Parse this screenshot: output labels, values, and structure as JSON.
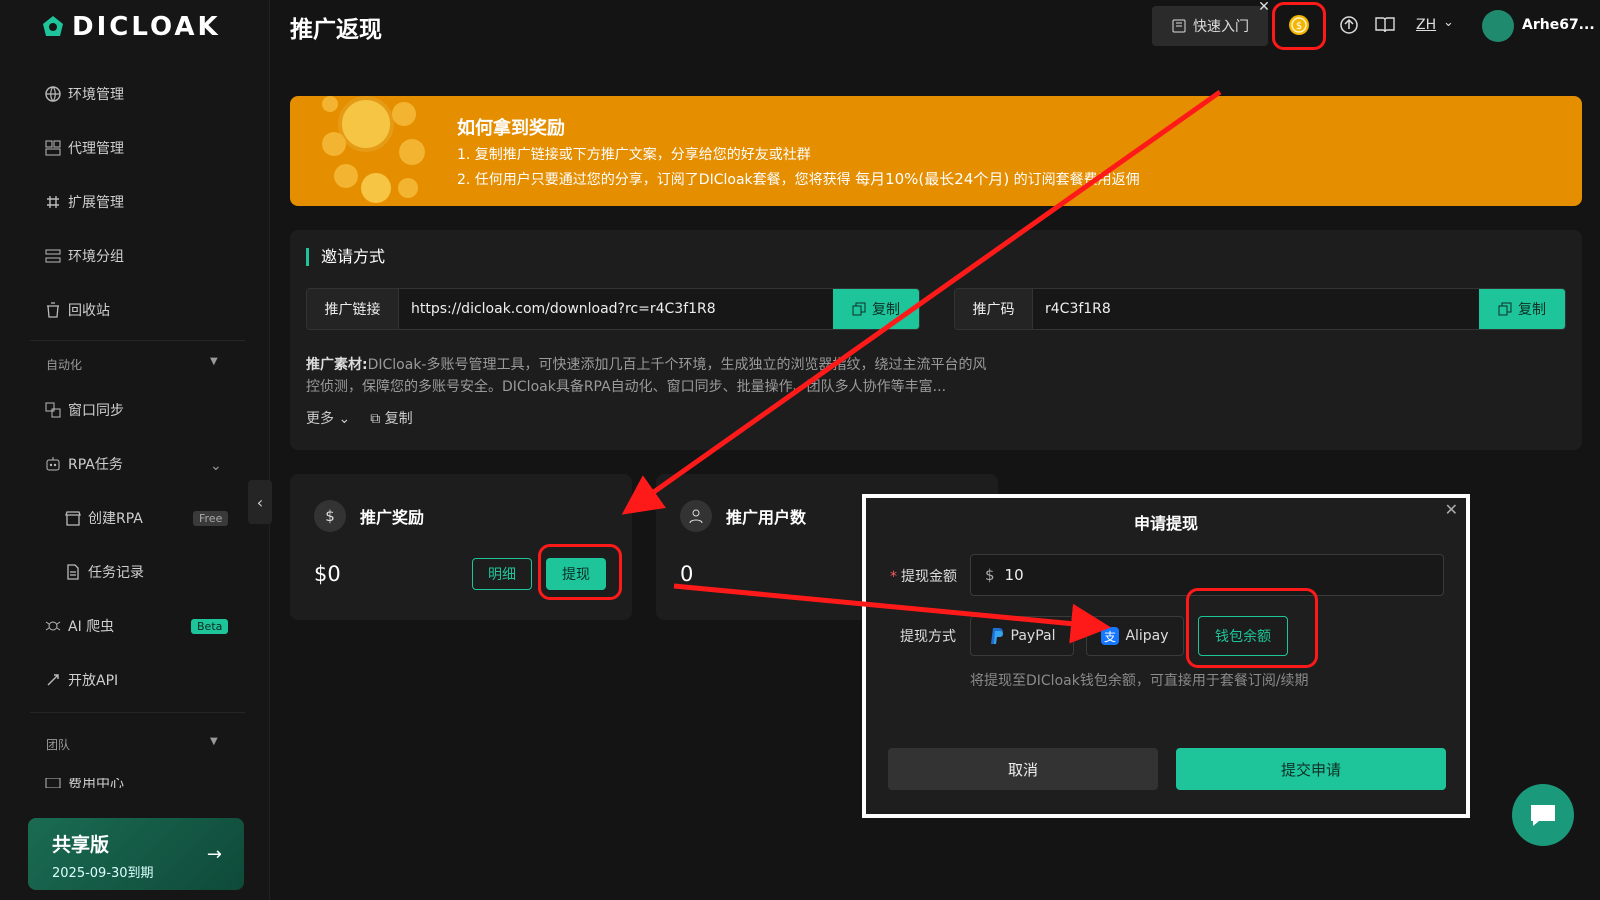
{
  "sidebar": {
    "logo": "DICLOAK",
    "items": [
      {
        "label": "环境管理",
        "icon": "globe-icon"
      },
      {
        "label": "代理管理",
        "icon": "proxy-icon"
      },
      {
        "label": "扩展管理",
        "icon": "extension-icon"
      },
      {
        "label": "环境分组",
        "icon": "group-icon"
      },
      {
        "label": "回收站",
        "icon": "trash-icon"
      }
    ],
    "automation_title": "自动化",
    "automation_items": [
      {
        "label": "窗口同步",
        "icon": "sync-icon"
      },
      {
        "label": "RPA任务",
        "icon": "robot-icon"
      },
      {
        "label": "创建RPA",
        "icon": "store-icon",
        "badge": "Free"
      },
      {
        "label": "任务记录",
        "icon": "doc-icon"
      },
      {
        "label": "AI 爬虫",
        "icon": "spider-icon",
        "badge": "Beta"
      },
      {
        "label": "开放API",
        "icon": "api-icon"
      }
    ],
    "team_title": "团队",
    "team_partial": "费用中心",
    "plan": {
      "name": "共享版",
      "expiry": "2025-09-30到期"
    }
  },
  "header": {
    "title": "推广返现",
    "quick_start": "快速入门",
    "lang": "ZH",
    "username": "Arhe67..."
  },
  "banner": {
    "title": "如何拿到奖励",
    "line1": "1. 复制推广链接或下方推广文案，分享给您的好友或社群",
    "line2_prefix": "2. 任何用户只要通过您的分享，订阅了DICloak套餐，您将获得 ",
    "line2_highlight": "每月10%(最长24个月)",
    "line2_suffix": " 的订阅套餐费用返佣"
  },
  "invite": {
    "title": "邀请方式",
    "link_label": "推广链接",
    "link_value": "https://dicloak.com/download?rc=r4C3f1R8",
    "code_label": "推广码",
    "code_value": "r4C3f1R8",
    "copy_label": "复制",
    "material_label": "推广素材:",
    "material_text": "DICloak-多账号管理工具，可快速添加几百上千个环境，生成独立的浏览器指纹，绕过主流平台的风控侦测，保障您的多账号安全。DICloak具备RPA自动化、窗口同步、批量操作、团队多人协作等丰富...",
    "more": "更多",
    "copy_text": "复制"
  },
  "stats": {
    "reward_title": "推广奖励",
    "reward_value": "$0",
    "detail_btn": "明细",
    "withdraw_btn": "提现",
    "users_title": "推广用户数",
    "users_value": "0"
  },
  "modal": {
    "title": "申请提现",
    "amount_label": "提现金额",
    "currency": "$",
    "amount_value": "10",
    "method_label": "提现方式",
    "methods": [
      "PayPal",
      "Alipay",
      "钱包余额"
    ],
    "hint": "将提现至DICloak钱包余额，可直接用于套餐订阅/续期",
    "cancel": "取消",
    "submit": "提交申请"
  },
  "colors": {
    "accent": "#1fc59a",
    "banner": "#e58e00",
    "annotation": "#ff1a1a"
  }
}
